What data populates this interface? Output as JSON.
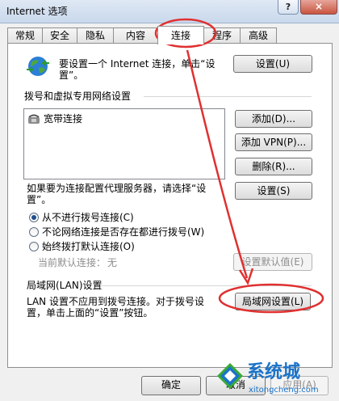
{
  "window": {
    "title": "Internet 选项",
    "help_label": "?",
    "close_label": "×"
  },
  "tabs": [
    {
      "label": "常规"
    },
    {
      "label": "安全"
    },
    {
      "label": "隐私"
    },
    {
      "label": "内容"
    },
    {
      "label": "连接",
      "active": true
    },
    {
      "label": "程序"
    },
    {
      "label": "高级"
    }
  ],
  "setup": {
    "text_line1": "要设置一个 Internet 连接，单击“设",
    "text_line2": "置”。",
    "button": "设置(U)"
  },
  "dialup": {
    "section_title": "拨号和虚拟专用网络设置",
    "connections": [
      "宽带连接"
    ],
    "add_button": "添加(D)...",
    "add_vpn_button": "添加 VPN(P)...",
    "remove_button": "删除(R)...",
    "proxy_text_line1": "如果要为连接配置代理服务器，请选择“设",
    "proxy_text_line2": "置”。",
    "settings_button": "设置(S)",
    "options": [
      {
        "label": "从不进行拨号连接(C)",
        "checked": true
      },
      {
        "label": "不论网络连接是否存在都进行拨号(W)",
        "checked": false
      },
      {
        "label": "始终拨打默认连接(O)",
        "checked": false
      }
    ],
    "current_default_label": "当前默认连接：",
    "current_default_value": "无",
    "set_default_button": "设置默认值(E)"
  },
  "lan": {
    "section_title": "局域网(LAN)设置",
    "text_line1": "LAN 设置不应用到拨号连接。对于拨号设",
    "text_line2": "置，单击上面的“设置”按钮。",
    "button": "局域网设置(L)"
  },
  "footer": {
    "ok_button": "确定",
    "cancel_button": "取消",
    "apply_button": "应用(A)"
  },
  "watermark": {
    "brand": "系统城",
    "url": "xitongcheng.com"
  },
  "colors": {
    "annotation_red": "#e03030",
    "watermark_blue": "#1a73c9",
    "watermark_green": "#3aa935",
    "radio_dot": "#1d4d8f"
  }
}
